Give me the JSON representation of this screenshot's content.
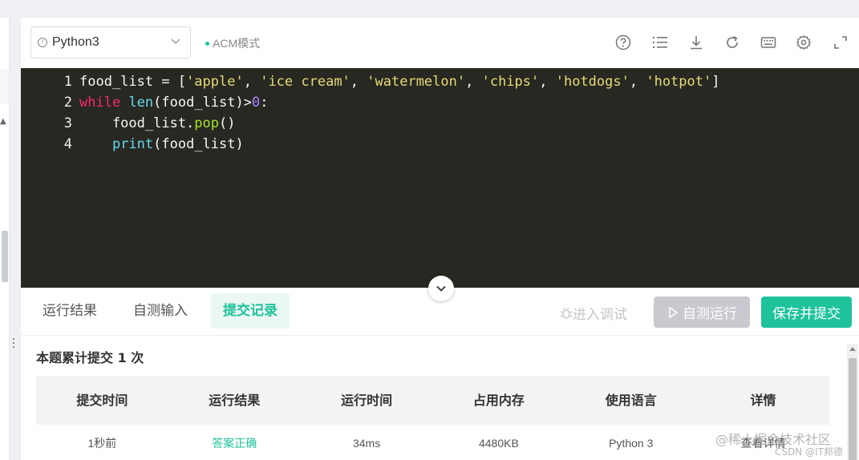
{
  "toolbar": {
    "language": "Python3",
    "mode": "ACM模式",
    "icons": [
      "help-icon",
      "list-icon",
      "download-icon",
      "reload-icon",
      "keyboard-icon",
      "settings-icon",
      "fullscreen-icon"
    ]
  },
  "code": {
    "lines": [
      {
        "num": "1",
        "parts": [
          {
            "t": "food_list = [",
            "c": "plain"
          },
          {
            "t": "'apple'",
            "c": "str"
          },
          {
            "t": ", ",
            "c": "plain"
          },
          {
            "t": "'ice cream'",
            "c": "str"
          },
          {
            "t": ", ",
            "c": "plain"
          },
          {
            "t": "'watermelon'",
            "c": "str"
          },
          {
            "t": ", ",
            "c": "plain"
          },
          {
            "t": "'chips'",
            "c": "str"
          },
          {
            "t": ", ",
            "c": "plain"
          },
          {
            "t": "'hotdogs'",
            "c": "str"
          },
          {
            "t": ", ",
            "c": "plain"
          },
          {
            "t": "'hotpot'",
            "c": "str"
          },
          {
            "t": "]",
            "c": "plain"
          }
        ]
      },
      {
        "num": "2",
        "parts": [
          {
            "t": "while",
            "c": "kw"
          },
          {
            "t": " ",
            "c": "plain"
          },
          {
            "t": "len",
            "c": "fn"
          },
          {
            "t": "(food_list)>",
            "c": "plain"
          },
          {
            "t": "0",
            "c": "num"
          },
          {
            "t": ":",
            "c": "plain"
          }
        ]
      },
      {
        "num": "3",
        "parts": [
          {
            "t": "    food_list.",
            "c": "plain"
          },
          {
            "t": "pop",
            "c": "meth"
          },
          {
            "t": "()",
            "c": "plain"
          }
        ]
      },
      {
        "num": "4",
        "parts": [
          {
            "t": "    ",
            "c": "plain"
          },
          {
            "t": "print",
            "c": "fn"
          },
          {
            "t": "(food_list)",
            "c": "plain"
          }
        ]
      }
    ]
  },
  "tabs": [
    {
      "label": "运行结果",
      "active": false
    },
    {
      "label": "自测输入",
      "active": false
    },
    {
      "label": "提交记录",
      "active": true
    }
  ],
  "actions": {
    "debug": "进入调试",
    "run": "自测运行",
    "submit": "保存并提交"
  },
  "summary": "本题累计提交 1 次",
  "table": {
    "headers": [
      "提交时间",
      "运行结果",
      "运行时间",
      "占用内存",
      "使用语言",
      "详情"
    ],
    "rows": [
      [
        "1秒前",
        "答案正确",
        "34ms",
        "4480KB",
        "Python 3",
        "查看详情"
      ]
    ]
  },
  "watermark": "@稀土掘金技术社区",
  "watermark_sub": "CSDN @IT邦德",
  "colors": {
    "accent": "#1ec29b",
    "editor_bg": "#272822"
  }
}
